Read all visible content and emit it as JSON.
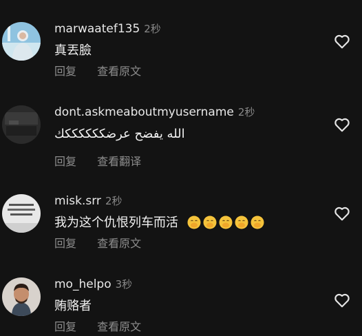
{
  "comments": [
    {
      "username": "marwaatef135",
      "time": "2秒",
      "text": "真丟臉",
      "reply_label": "回复",
      "view_label": "查看原文"
    },
    {
      "username": "dont.askmeaboutmyusername",
      "time": "2秒",
      "text": "الله يفضح عرضككككككك",
      "reply_label": "回复",
      "view_label": "查看翻译"
    },
    {
      "username": "misk.srr",
      "time": "2秒",
      "text": "我为这个仇恨列车而活",
      "reply_label": "回复",
      "view_label": "查看原文"
    },
    {
      "username": "mo_helpo",
      "time": "3秒",
      "text": "贿赂者",
      "reply_label": "回复",
      "view_label": "查看原文"
    }
  ],
  "icons": {
    "like": "heart-outline-icon",
    "emoji": "hand-over-mouth-emoji"
  },
  "emoji_count": 5,
  "colors": {
    "background": "#131313",
    "username": "#e9e9e9",
    "secondary": "#8d8d8d",
    "text": "#f2f2f2"
  }
}
